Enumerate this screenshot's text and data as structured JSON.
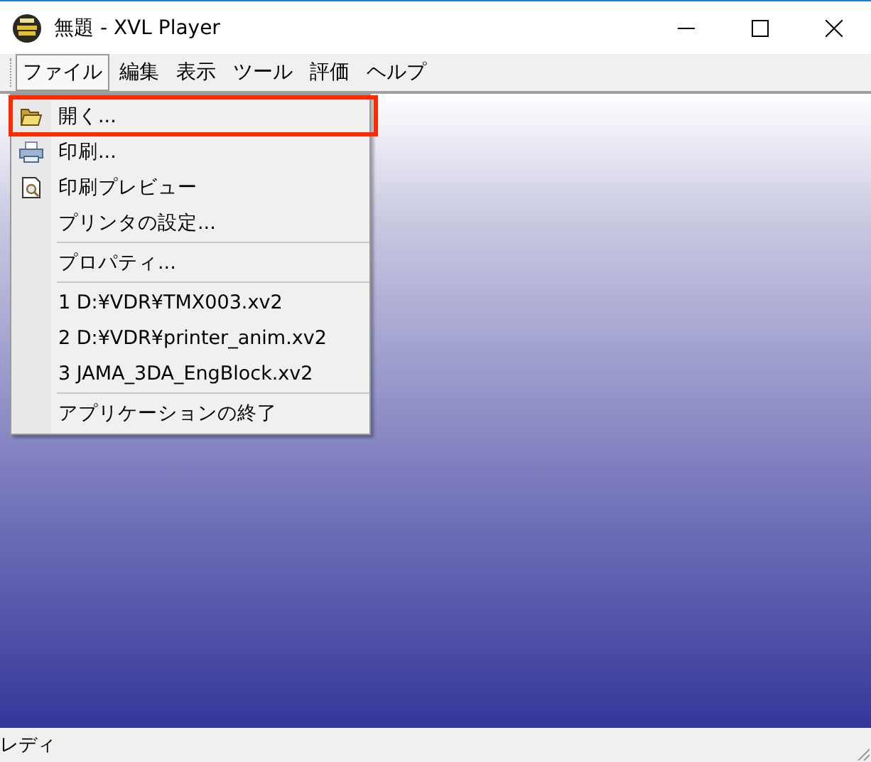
{
  "window": {
    "title": "無題 - XVL Player"
  },
  "menubar": [
    {
      "label": "ファイル",
      "selected": true
    },
    {
      "label": "編集",
      "selected": false
    },
    {
      "label": "表示",
      "selected": false
    },
    {
      "label": "ツール",
      "selected": false
    },
    {
      "label": "評価",
      "selected": false
    },
    {
      "label": "ヘルプ",
      "selected": false
    }
  ],
  "file_menu": [
    {
      "kind": "item",
      "label": "開く...",
      "highlighted": true
    },
    {
      "kind": "item",
      "label": "印刷...",
      "highlighted": false
    },
    {
      "kind": "item",
      "label": "印刷プレビュー",
      "highlighted": false
    },
    {
      "kind": "item",
      "label": "プリンタの設定...",
      "highlighted": false
    },
    {
      "kind": "separator"
    },
    {
      "kind": "item",
      "label": "プロパティ...",
      "highlighted": false
    },
    {
      "kind": "separator"
    },
    {
      "kind": "item",
      "label": "1 D:¥VDR¥TMX003.xv2",
      "highlighted": false
    },
    {
      "kind": "item",
      "label": "2 D:¥VDR¥printer_anim.xv2",
      "highlighted": false
    },
    {
      "kind": "item",
      "label": "3 JAMA_3DA_EngBlock.xv2",
      "highlighted": false
    },
    {
      "kind": "separator"
    },
    {
      "kind": "item",
      "label": "アプリケーションの終了",
      "highlighted": false
    }
  ],
  "status_bar": {
    "text": "レディ"
  }
}
